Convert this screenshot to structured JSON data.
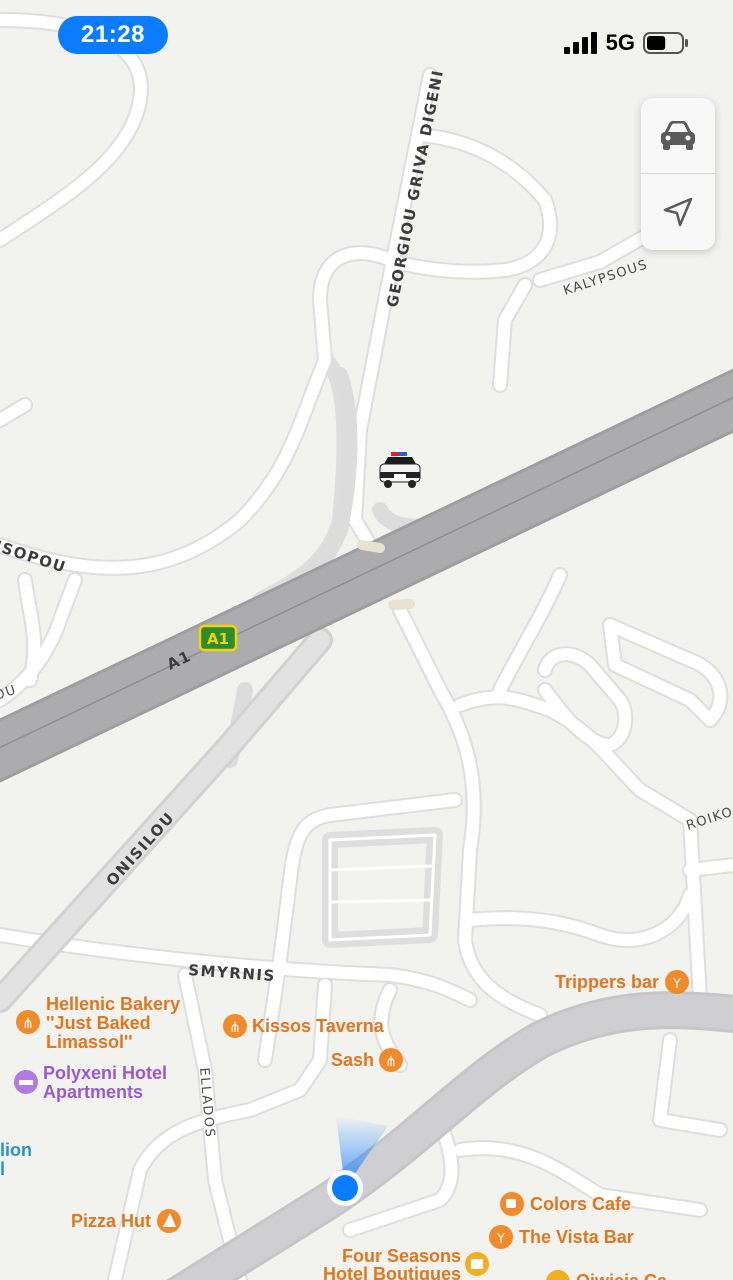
{
  "status_bar": {
    "time": "21:28",
    "network": "5G",
    "signal_bars": 4,
    "battery_fraction": 0.55
  },
  "map_controls": {
    "top_icon": "car-icon",
    "bottom_icon": "location-arrow-icon"
  },
  "roads": {
    "georgiou": "GEORGIOU GRIVA DIGENI",
    "kalypsous": "KALYPSOUS",
    "isopou": "ISOPOU",
    "a1": "A1",
    "a1_shield": "A1",
    "onisilou": "ONISILOU",
    "smyrnis": "SMYRNIS",
    "ellados": "ELLADOS",
    "roiko": "ROIKO",
    "ou": "OU"
  },
  "pois": {
    "hellenic": [
      "Hellenic Bakery",
      "''Just Baked",
      "Limassol''"
    ],
    "kissos": "Kissos Taverna",
    "sash": "Sash",
    "trippers": "Trippers bar",
    "polyxeni": [
      "Polyxeni Hotel",
      "Apartments"
    ],
    "lion": [
      "lion",
      "l"
    ],
    "pizza": "Pizza Hut",
    "colors": "Colors Cafe",
    "vista": "The Vista Bar",
    "four_seasons": [
      "Four Seasons",
      "Hotel Boutiques"
    ],
    "partial": "Oiwieia Ca"
  },
  "colors": {
    "map_bg": "#f2f2ef",
    "highway": "#a9a9ab",
    "road": "#ffffff",
    "poi_orange": "#e0761e",
    "poi_purple": "#9b59d0",
    "user_dot": "#0a7cff"
  }
}
